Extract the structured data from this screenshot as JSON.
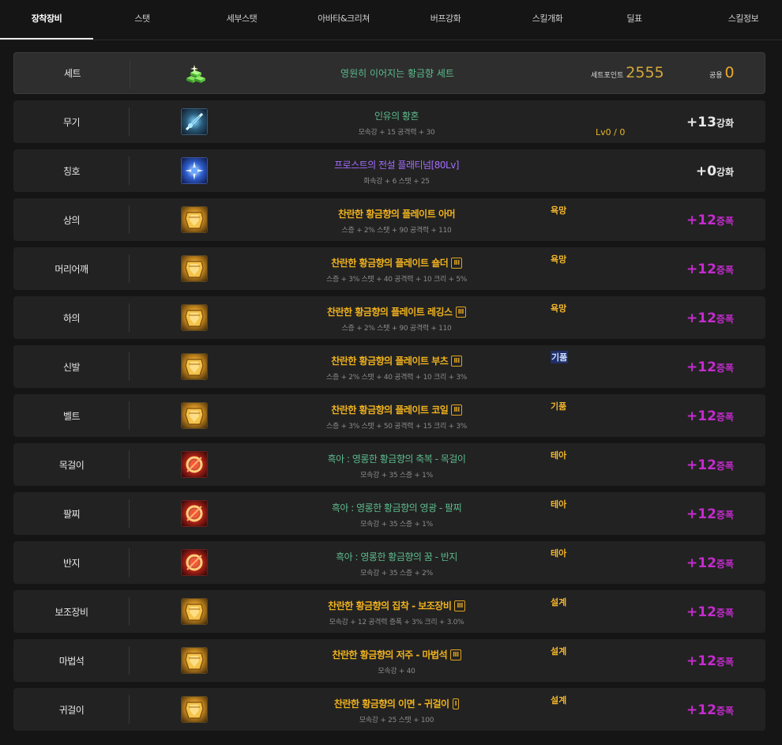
{
  "tabs": [
    {
      "label": "장착장비",
      "active": true
    },
    {
      "label": "스탯"
    },
    {
      "label": "세부스탯"
    },
    {
      "label": "아바타&크리쳐"
    },
    {
      "label": "버프강화"
    },
    {
      "label": "스킬개화"
    },
    {
      "label": "딜표"
    },
    {
      "label": "스킬정보"
    }
  ],
  "set": {
    "slot": "세트",
    "icon": "gold-bars-icon",
    "name": "영원히 이어지는 황금향 세트",
    "point_label": "세트포인트",
    "point_value": "2555",
    "common_label": "공용",
    "common_value": "0"
  },
  "items": [
    {
      "slot": "무기",
      "icon": "weapon-icon",
      "name": "인유의 황혼",
      "name_color": "green",
      "sub": "모속강 + 15 공격력 + 30",
      "lv": "Lv0 / 0",
      "enh": "+13",
      "enh_unit": "강화",
      "enh_color": "white"
    },
    {
      "slot": "칭호",
      "icon": "title-icon",
      "name": "프로스트의 전설 플래티넘[80Lv]",
      "name_color": "purple",
      "sub": "화속강 + 6 스탯 + 25",
      "enh": "+0",
      "enh_unit": "강화",
      "enh_color": "white"
    },
    {
      "slot": "상의",
      "icon": "armor-top-icon",
      "name": "찬란한 황금향의 플레이트 아머",
      "name_color": "gold",
      "sub": "스증 + 2% 스탯 + 90 공격력 + 110",
      "tag": "욕망",
      "enh": "+12",
      "enh_unit": "증폭",
      "enh_color": "magenta"
    },
    {
      "slot": "머리어깨",
      "icon": "shoulder-icon",
      "name": "찬란한 황금향의 플레이트 숄더",
      "name_color": "gold",
      "badge": "III",
      "sub": "스증 + 3% 스탯 + 40 공격력 + 10 크리 + 5%",
      "tag": "욕망",
      "enh": "+12",
      "enh_unit": "증폭",
      "enh_color": "magenta"
    },
    {
      "slot": "하의",
      "icon": "leggings-icon",
      "name": "찬란한 황금향의 플레이트 레깅스",
      "name_color": "gold",
      "badge": "III",
      "sub": "스증 + 2% 스탯 + 90 공격력 + 110",
      "tag": "욕망",
      "enh": "+12",
      "enh_unit": "증폭",
      "enh_color": "magenta"
    },
    {
      "slot": "신발",
      "icon": "boots-icon",
      "name": "찬란한 황금향의 플레이트 부츠",
      "name_color": "gold",
      "badge": "III",
      "sub": "스증 + 2% 스탯 + 40 공격력 + 10 크리 + 3%",
      "tag": "기품",
      "tag_style": "blue",
      "enh": "+12",
      "enh_unit": "증폭",
      "enh_color": "magenta"
    },
    {
      "slot": "벨트",
      "icon": "belt-icon",
      "name": "찬란한 황금향의 플레이트 코일",
      "name_color": "gold",
      "badge": "III",
      "sub": "스증 + 3% 스탯 + 50 공격력 + 15 크리 + 3%",
      "tag": "기품",
      "enh": "+12",
      "enh_unit": "증폭",
      "enh_color": "magenta"
    },
    {
      "slot": "목걸이",
      "icon": "necklace-icon",
      "name": "흑아 : 영롱한 황금향의 축복 - 목걸이",
      "name_color": "green",
      "sub": "모속강 + 35 스증 + 1%",
      "tag": "테아",
      "enh": "+12",
      "enh_unit": "증폭",
      "enh_color": "magenta"
    },
    {
      "slot": "팔찌",
      "icon": "bracelet-icon",
      "name": "흑아 : 영롱한 황금향의 영광 - 팔찌",
      "name_color": "green",
      "sub": "모속강 + 35 스증 + 1%",
      "tag": "테아",
      "enh": "+12",
      "enh_unit": "증폭",
      "enh_color": "magenta"
    },
    {
      "slot": "반지",
      "icon": "ring-icon",
      "name": "흑아 : 영롱한 황금향의 꿈 - 반지",
      "name_color": "green",
      "sub": "모속강 + 35 스증 + 2%",
      "tag": "테아",
      "enh": "+12",
      "enh_unit": "증폭",
      "enh_color": "magenta"
    },
    {
      "slot": "보조장비",
      "icon": "sub-equip-icon",
      "name": "찬란한 황금향의 집착 - 보조장비",
      "name_color": "gold",
      "badge": "III",
      "sub": "모속강 + 12 공격력 증폭 + 3% 크리 + 3.0%",
      "tag": "설계",
      "enh": "+12",
      "enh_unit": "증폭",
      "enh_color": "magenta"
    },
    {
      "slot": "마법석",
      "icon": "magic-stone-icon",
      "name": "찬란한 황금향의 저주 - 마법석",
      "name_color": "gold",
      "badge": "III",
      "sub": "모속강 + 40",
      "tag": "설계",
      "enh": "+12",
      "enh_unit": "증폭",
      "enh_color": "magenta"
    },
    {
      "slot": "귀걸이",
      "icon": "earring-icon",
      "name": "찬란한 황금향의 이면 - 귀걸이",
      "name_color": "gold",
      "badge": "I",
      "sub": "모속강 + 25 스탯 + 100",
      "tag": "설계",
      "enh": "+12",
      "enh_unit": "증폭",
      "enh_color": "magenta"
    }
  ]
}
